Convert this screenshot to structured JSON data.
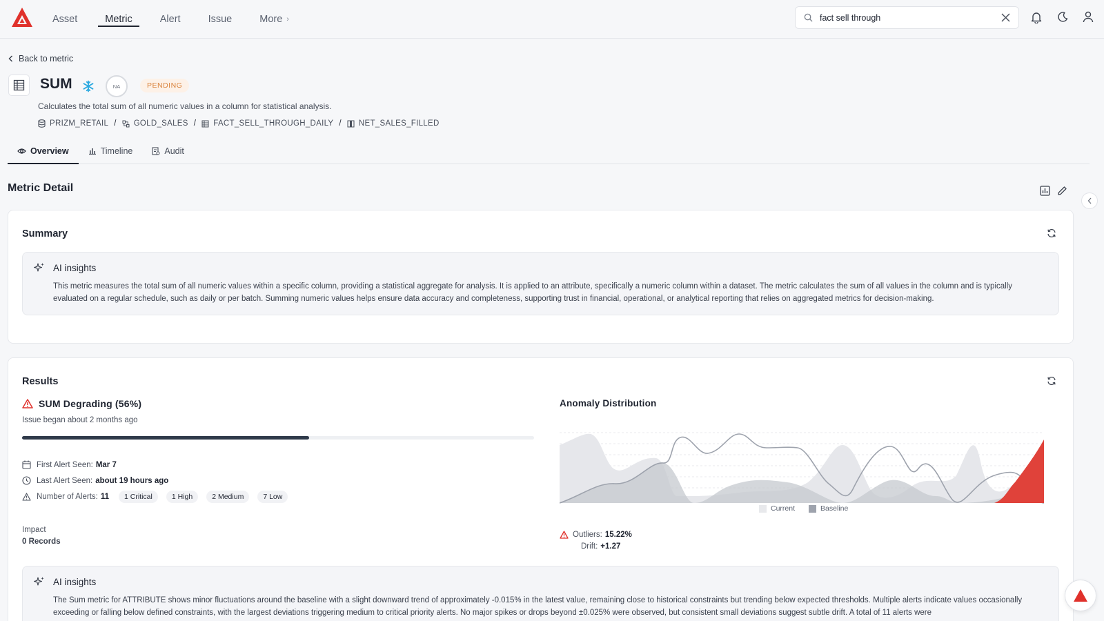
{
  "nav": {
    "items": [
      {
        "label": "Asset"
      },
      {
        "label": "Metric"
      },
      {
        "label": "Alert"
      },
      {
        "label": "Issue"
      },
      {
        "label": "More"
      }
    ]
  },
  "search": {
    "value": "fact sell through"
  },
  "header": {
    "back_label": "Back to metric",
    "title": "SUM",
    "score": "NA",
    "status": "PENDING",
    "description": "Calculates the total sum of all numeric values in a column for statistical analysis.",
    "path": [
      "PRIZM_RETAIL",
      "GOLD_SALES",
      "FACT_SELL_THROUGH_DAILY",
      "NET_SALES_FILLED"
    ]
  },
  "tabs": [
    {
      "label": "Overview"
    },
    {
      "label": "Timeline"
    },
    {
      "label": "Audit"
    }
  ],
  "section_title": "Metric Detail",
  "summary": {
    "title": "Summary",
    "ai_title": "AI insights",
    "ai_text": "This metric measures the total sum of all numeric values within a specific column, providing a statistical aggregate for analysis. It is applied to an attribute, specifically a numeric column within a dataset. The metric calculates the sum of all values in the column and is typically evaluated on a regular schedule, such as daily or per batch. Summing numeric values helps ensure data accuracy and completeness, supporting trust in financial, operational, or analytical reporting that relies on aggregated metrics for decision-making."
  },
  "results": {
    "title": "Results",
    "degrading_title": "SUM Degrading (56%)",
    "degrading_progress": 0.56,
    "issue_began": "Issue began about 2 months ago",
    "first_alert_label": "First Alert Seen:",
    "first_alert_value": "Mar 7",
    "last_alert_label": "Last Alert Seen:",
    "last_alert_value": "about 19 hours ago",
    "alerts_label": "Number of Alerts:",
    "alerts_value": "11",
    "severity_pills": [
      "1 Critical",
      "1 High",
      "2 Medium",
      "7 Low"
    ],
    "impact_label": "Impact",
    "impact_value": "0 Records",
    "anomaly_title": "Anomaly Distribution",
    "legend": [
      {
        "name": "Current",
        "color": "#e8e9ec"
      },
      {
        "name": "Baseline",
        "color": "#9ea3ad"
      }
    ],
    "outliers_label": "Outliers:",
    "outliers_value": "15.22%",
    "drift_label": "Drift:",
    "drift_value": "+1.27",
    "ai_title": "AI insights",
    "ai_text": "The Sum metric for ATTRIBUTE shows minor fluctuations around the baseline with a slight downward trend of approximately -0.015% in the latest value, remaining close to historical constraints but trending below expected thresholds. Multiple alerts indicate values occasionally exceeding or falling below defined constraints, with the largest deviations triggering medium to critical priority alerts. No major spikes or drops beyond ±0.025% were observed, but consistent small deviations suggest subtle drift. A total of 11 alerts were"
  },
  "colors": {
    "accent": "#1f2430",
    "brand_red": "#e0312b",
    "pending_text": "#d9823b",
    "pending_bg": "#fdf1e7",
    "snowflake": "#29a8e0",
    "anomaly_red": "#e0423a"
  }
}
